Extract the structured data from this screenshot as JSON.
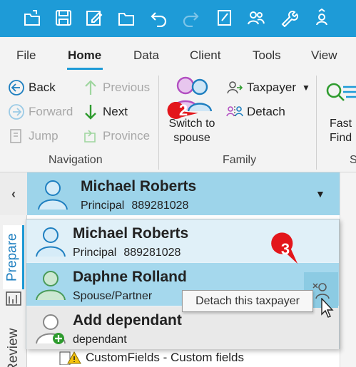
{
  "ribbon_tabs": [
    "File",
    "Home",
    "Data",
    "Client",
    "Tools",
    "View"
  ],
  "navigation": {
    "back": "Back",
    "forward": "Forward",
    "jump": "Jump",
    "previous": "Previous",
    "next": "Next",
    "province": "Province",
    "group_label": "Navigation"
  },
  "family": {
    "switch_label_line1": "Switch to",
    "switch_label_line2": "spouse",
    "taxpayer": "Taxpayer",
    "detach": "Detach",
    "group_label": "Family"
  },
  "fast_find": {
    "line1": "Fast",
    "line2": "Find",
    "group_label": "S"
  },
  "side_tabs": {
    "prepare": "Prepare",
    "review": "Review"
  },
  "header": {
    "name": "Michael Roberts",
    "role": "Principal",
    "id": "889281028"
  },
  "dropdown": {
    "items": [
      {
        "name": "Michael Roberts",
        "role": "Principal",
        "id": "889281028"
      },
      {
        "name": "Daphne Rolland",
        "role": "Spouse/Partner",
        "id": ""
      },
      {
        "name": "Add dependant",
        "role": "dependant",
        "id": ""
      }
    ]
  },
  "tooltip": "Detach this taxpayer",
  "callouts": [
    "2",
    "3"
  ],
  "tree": {
    "item": "CustomFields - Custom fields"
  },
  "colors": {
    "titlebar": "#1e9bd7",
    "header_band": "#9dd4ea",
    "selected_row": "#a5d8ed",
    "callout": "#e3161b"
  }
}
